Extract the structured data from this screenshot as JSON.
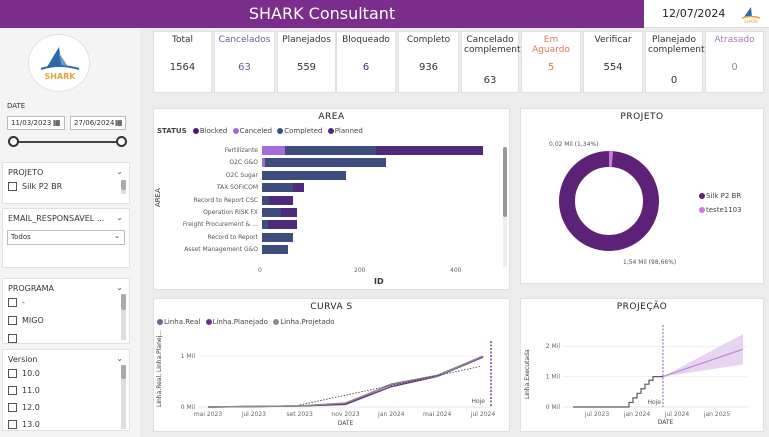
{
  "header": {
    "title": "SHARK Consultant",
    "date": "12/07/2024",
    "logo_text": "SHARK"
  },
  "sidebar": {
    "logo_text": "SHARK",
    "date_filter": {
      "label": "DATE",
      "start": "11/03/2023",
      "end": "27/06/2024"
    },
    "projeto": {
      "label": "PROJETO",
      "items": [
        "Silk P2 BR"
      ]
    },
    "email": {
      "label": "EMAIL_RESPONSAVEL ...",
      "value": "Todos"
    },
    "programa": {
      "label": "PROGRAMA",
      "items": [
        "-",
        "MIGO",
        ""
      ]
    },
    "version": {
      "label": "Version",
      "items": [
        "10.0",
        "11.0",
        "12.0",
        "13.0"
      ]
    }
  },
  "kpis": [
    {
      "label": "Total",
      "value": "1564",
      "label_color": "#333333",
      "value_color": "#333333"
    },
    {
      "label": "Cancelados",
      "value": "63",
      "label_color": "#6a5a9a",
      "value_color": "#6a5a9a"
    },
    {
      "label": "Planejados",
      "value": "559",
      "label_color": "#333333",
      "value_color": "#333333"
    },
    {
      "label": "Bloqueado",
      "value": "6",
      "label_color": "#333333",
      "value_color": "#5a2a7a"
    },
    {
      "label": "Completo",
      "value": "936",
      "label_color": "#333333",
      "value_color": "#333333"
    },
    {
      "label": "Cancelado complementar",
      "value": "63",
      "label_color": "#333333",
      "value_color": "#333333"
    },
    {
      "label": "Em Aguardo",
      "value": "5",
      "label_color": "#d9785a",
      "value_color": "#d9785a"
    },
    {
      "label": "Verificar",
      "value": "554",
      "label_color": "#333333",
      "value_color": "#333333"
    },
    {
      "label": "Planejado complementar",
      "value": "0",
      "label_color": "#333333",
      "value_color": "#333333"
    },
    {
      "label": "Atrasado",
      "value": "0",
      "label_color": "#a07ab5",
      "value_color": "#a07ab5"
    }
  ],
  "colors": {
    "blocked": "#4a1a6b",
    "canceled": "#a86ad6",
    "completed": "#3d4d7e",
    "planned": "#4f2a7a",
    "brand": "#7b2d8b",
    "projection_band": "#e6d4f0"
  },
  "chart_data": [
    {
      "type": "bar",
      "title": "AREA",
      "legend_title": "STATUS",
      "xlabel": "ID",
      "ylabel": "AREA",
      "xlim": [
        0,
        500
      ],
      "xticks": [
        "0",
        "200",
        "400"
      ],
      "categories": [
        "Fertilizante",
        "O2C   G&O",
        "O2C   Sugar",
        "TAX SOFICOM",
        "Record to Report   CSC",
        "Operation RISK   FX",
        "Freight Procurement & ...",
        "Record  to Report",
        "Asset Management G&O"
      ],
      "series": [
        {
          "name": "Blocked",
          "values": [
            0,
            0,
            0,
            0,
            0,
            0,
            0,
            0,
            0
          ]
        },
        {
          "name": "Canceled",
          "values": [
            48,
            6,
            0,
            0,
            0,
            0,
            0,
            0,
            0
          ]
        },
        {
          "name": "Completed",
          "values": [
            190,
            252,
            176,
            64,
            14,
            40,
            12,
            65,
            55
          ]
        },
        {
          "name": "Planned",
          "values": [
            222,
            0,
            0,
            24,
            50,
            32,
            60,
            0,
            0
          ]
        }
      ],
      "legend_position": "top"
    },
    {
      "type": "pie",
      "title": "PROJETO",
      "slices": [
        {
          "name": "Silk P2 BR",
          "value": 1.54,
          "label": "1,54 Mil (98,66%)"
        },
        {
          "name": "teste1103",
          "value": 0.02,
          "label": "0,02 Mil (1,34%)"
        }
      ],
      "legend_position": "right"
    },
    {
      "type": "line",
      "title": "CURVA S",
      "xlabel": "DATE",
      "ylabel": "Linha.Real, Linha.Planej...",
      "x": [
        "mai 2023",
        "jul 2023",
        "set 2023",
        "nov 2023",
        "jan 2024",
        "mai 2024",
        "jul 2024"
      ],
      "yticks": [
        "0 Mil",
        "1 Mil"
      ],
      "ylim": [
        0,
        1.1
      ],
      "series": [
        {
          "name": "Linha.Real",
          "values": [
            0.0,
            0.01,
            0.02,
            0.06,
            0.45,
            0.62,
            1.0
          ]
        },
        {
          "name": "Linha.Planejado",
          "values": [
            0.0,
            0.01,
            0.02,
            0.05,
            0.4,
            0.6,
            0.98
          ]
        },
        {
          "name": "Linha.Projetado",
          "values": [
            0.0,
            0.01,
            0.02,
            0.08,
            0.44,
            0.61,
            1.0
          ]
        }
      ],
      "annotation": "Hoje",
      "legend_position": "top"
    },
    {
      "type": "line",
      "title": "PROJEÇÃO",
      "xlabel": "DATE",
      "ylabel": "Linha.Executada",
      "x": [
        "jul 2023",
        "jan 2024",
        "jul 2024",
        "jan 2025"
      ],
      "yticks": [
        "0 Mil",
        "1 Mil",
        "2 Mil"
      ],
      "ylim": [
        0,
        2.5
      ],
      "series": [
        {
          "name": "Linha.Executada",
          "values": [
            0.0,
            0.3,
            1.0,
            1.0
          ]
        }
      ],
      "forecast": {
        "from": 1.0,
        "to": 1.9,
        "upper": 2.4,
        "lower": 1.4
      },
      "annotation": "Hoje"
    }
  ]
}
